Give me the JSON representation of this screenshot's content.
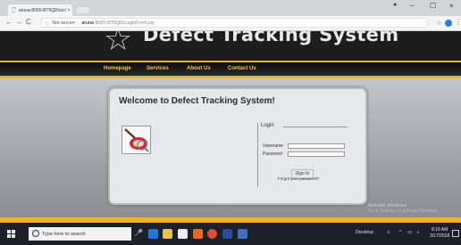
{
  "browser": {
    "tab_title": "aruna-8000-BT6QR/src/ ×",
    "window_controls": [
      "−",
      "☐",
      "×"
    ],
    "secure_label": "Not secure",
    "url_host": "aruna",
    "url_path": "-8000-BT6QR/LoginForm.jsp"
  },
  "header": {
    "title": "Defect Tracking System"
  },
  "nav": {
    "items": [
      "Homepage",
      "Services",
      "About Us",
      "Contact Us"
    ]
  },
  "panel": {
    "welcome": "Welcome to Defect Tracking System!"
  },
  "login": {
    "legend": "Login",
    "username_label": "Username",
    "password_label": "Password",
    "username_value": "",
    "password_value": "",
    "signin_label": "Sign In",
    "forgot_label": "Forgot your password?"
  },
  "watermark": {
    "line1": "Activate Windows",
    "line2": "Go to Settings to activate Windows."
  },
  "taskbar": {
    "search_placeholder": "Type here to search",
    "desktop_label": "Desktop",
    "time": "8:19 AM",
    "date": "3/17/2018"
  },
  "colors": {
    "accent_gold": "#f0b21e",
    "nav_text": "#f2c548",
    "header_bg": "#1d1d1d"
  }
}
